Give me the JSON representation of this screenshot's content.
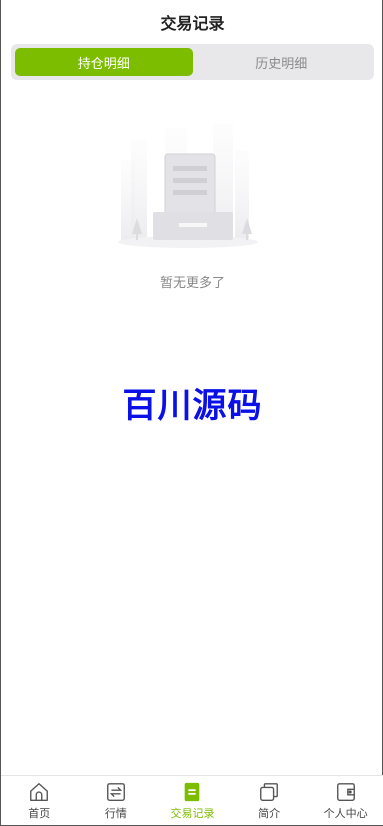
{
  "header": {
    "title": "交易记录"
  },
  "segment": {
    "tabs": [
      {
        "label": "持仓明细",
        "active": true
      },
      {
        "label": "历史明细",
        "active": false
      }
    ]
  },
  "empty": {
    "text": "暂无更多了",
    "icon": "empty-box-icon"
  },
  "watermark": {
    "text": "百川源码"
  },
  "tabbar": {
    "items": [
      {
        "label": "首页",
        "icon": "home-icon",
        "active": false
      },
      {
        "label": "行情",
        "icon": "exchange-icon",
        "active": false
      },
      {
        "label": "交易记录",
        "icon": "document-icon",
        "active": true
      },
      {
        "label": "简介",
        "icon": "copy-icon",
        "active": false
      },
      {
        "label": "个人中心",
        "icon": "wallet-icon",
        "active": false
      }
    ]
  },
  "colors": {
    "accent": "#7dbd00",
    "watermark": "#0a10e6",
    "segment_bg": "#e8e8ea"
  }
}
